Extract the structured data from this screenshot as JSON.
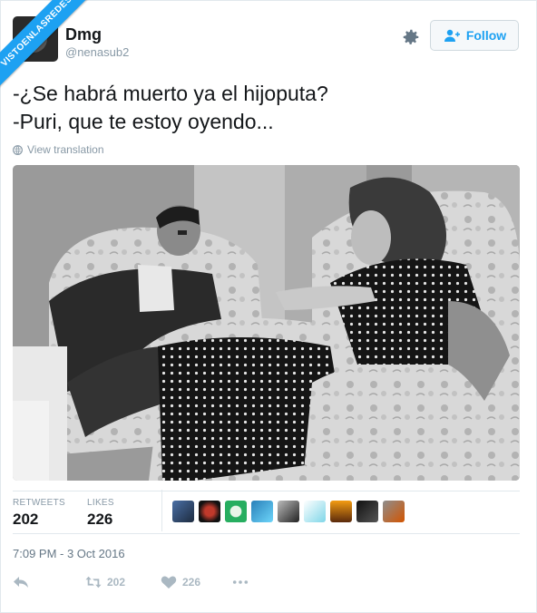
{
  "watermark": "VISTOENLASREDES",
  "user": {
    "name": "Dmg",
    "handle": "@nenasub2"
  },
  "follow_label": "Follow",
  "tweet": {
    "line1": "-¿Se habrá muerto ya el hijoputa?",
    "line2": "-Puri, que te estoy oyendo..."
  },
  "translation_label": "View translation",
  "stats": {
    "retweets_label": "RETWEETS",
    "retweets_value": "202",
    "likes_label": "LIKES",
    "likes_value": "226"
  },
  "timestamp": "7:09 PM - 3 Oct 2016",
  "actions": {
    "retweet_count": "202",
    "like_count": "226"
  },
  "colors": {
    "accent": "#1da1f2",
    "muted": "#8899a6"
  },
  "icons": [
    "gear-icon",
    "add-user-icon",
    "globe-icon",
    "reply-icon",
    "retweet-icon",
    "heart-icon",
    "more-icon"
  ]
}
